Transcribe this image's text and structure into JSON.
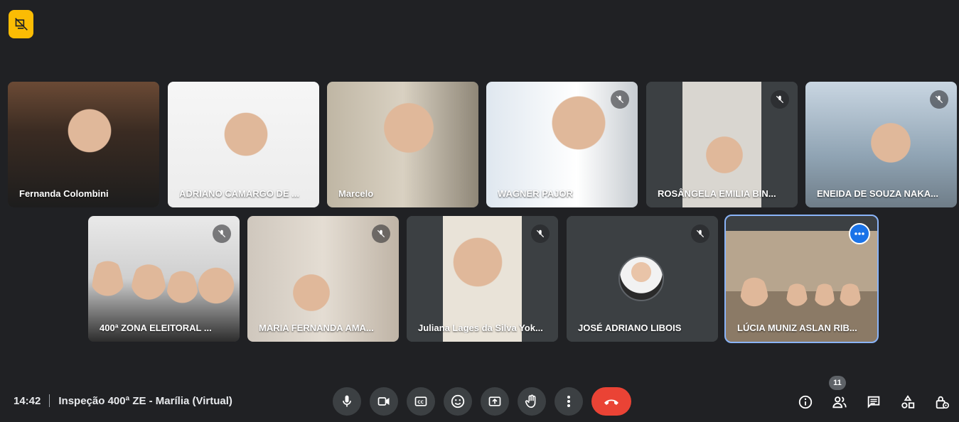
{
  "participants": [
    {
      "name": "Fernanda Colombini",
      "muted": false
    },
    {
      "name": "ADRIANO CAMARGO DE ...",
      "muted": false
    },
    {
      "name": "Marcelo",
      "muted": false
    },
    {
      "name": "WAGNER PAJOR",
      "muted": true
    },
    {
      "name": "ROSÂNGELA EMILIA BIN...",
      "muted": true
    },
    {
      "name": "ENEIDA DE SOUZA NAKA...",
      "muted": true
    },
    {
      "name": "400ª ZONA ELEITORAL ...",
      "muted": true
    },
    {
      "name": "MARIA FERNANDA AMA...",
      "muted": true
    },
    {
      "name": "Juliana Lages da Silva Yok...",
      "muted": true
    },
    {
      "name": "JOSÉ ADRIANO LIBOIS",
      "muted": true
    },
    {
      "name": "LÚCIA MUNIZ ASLAN RIB...",
      "muted": false
    }
  ],
  "meeting": {
    "time": "14:42",
    "title": "Inspeção 400ª ZE - Marília (Virtual)"
  },
  "people_count": "11",
  "colors": {
    "background": "#202124",
    "tile": "#3c4043",
    "end_call": "#ea4335",
    "accent": "#8ab4f8",
    "badge_yellow": "#fbbc04"
  },
  "icons": [
    "no-video-badge-icon",
    "mic-off-icon",
    "more-options-icon",
    "mic-icon",
    "camera-icon",
    "captions-icon",
    "emoji-icon",
    "present-icon",
    "raise-hand-icon",
    "more-vert-icon",
    "end-call-icon",
    "info-icon",
    "people-icon",
    "chat-icon",
    "activities-icon",
    "host-controls-icon"
  ]
}
